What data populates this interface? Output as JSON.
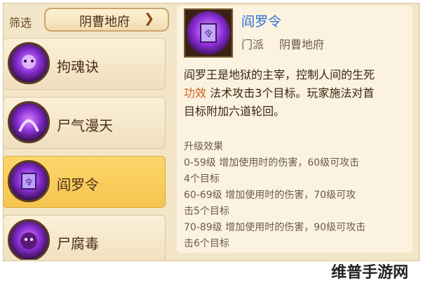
{
  "header": {
    "filter_label": "筛选",
    "dropdown_value": "阴曹地府"
  },
  "skills": [
    {
      "label": "拘魂诀"
    },
    {
      "label": "尸气漫天"
    },
    {
      "label": "阎罗令"
    },
    {
      "label": "尸腐毒"
    }
  ],
  "selected_skill_index": 2,
  "detail": {
    "title": "阎罗令",
    "sect_label": "门派",
    "sect_value": "阴曹地府",
    "desc_line1": "阎罗王是地狱的主宰，控制人间的生死",
    "desc_highlight": "功效",
    "desc_line2_rest": "法术攻击3个目标。玩家施法对首",
    "desc_line3": "目标附加六道轮回。",
    "upgrade_title": "升级效果",
    "upgrade_lines": [
      "0-59级  增加使用时的伤害，60级可攻击",
      "4个目标",
      "60-69级  增加使用时的伤害，70级可攻",
      "击5个目标",
      "70-89级  增加使用时的伤害，90级可攻击",
      "击6个目标"
    ]
  },
  "watermark": "维普手游网",
  "colors": {
    "panel_bg": "#f3e6c8",
    "selected_bg": "#f5c451",
    "title_blue": "#2f6fd6",
    "highlight_orange": "#c8601a"
  }
}
